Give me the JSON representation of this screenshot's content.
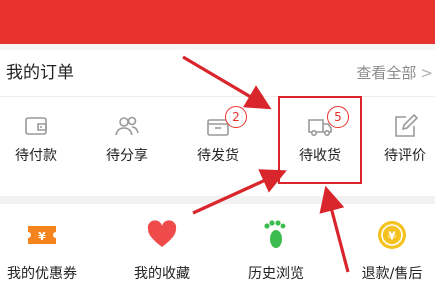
{
  "orders": {
    "title": "我的订单",
    "view_all": "查看全部",
    "view_all_chevron": ">",
    "statuses": [
      {
        "label": "待付款",
        "icon": "wallet-icon"
      },
      {
        "label": "待分享",
        "icon": "users-icon"
      },
      {
        "label": "待发货",
        "icon": "package-icon",
        "badge": "2"
      },
      {
        "label": "待收货",
        "icon": "truck-icon",
        "badge": "5"
      },
      {
        "label": "待评价",
        "icon": "edit-icon"
      }
    ]
  },
  "services": [
    {
      "label": "我的优惠券",
      "icon": "coupon-icon",
      "color": "#f5841f"
    },
    {
      "label": "我的收藏",
      "icon": "heart-icon",
      "color": "#ef4b4b"
    },
    {
      "label": "历史浏览",
      "icon": "footprint-icon",
      "color": "#3cbc4e"
    },
    {
      "label": "退款/售后",
      "icon": "refund-coin-icon",
      "color": "#f5c11e"
    }
  ],
  "colors": {
    "brand_red": "#e8322d",
    "annotation_red": "#d8262c",
    "icon_gray": "#9a9a9a"
  }
}
